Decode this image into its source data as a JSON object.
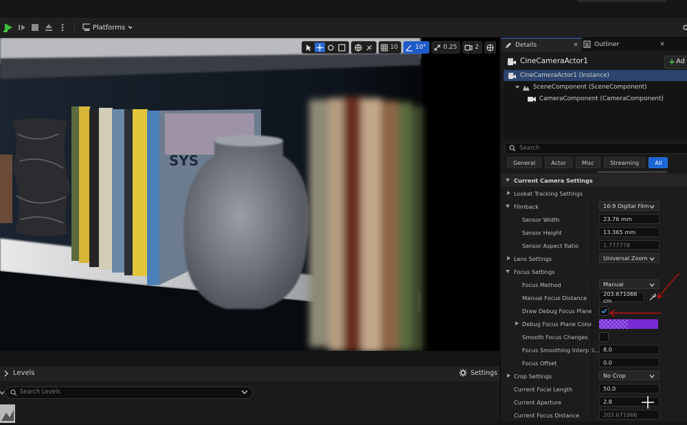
{
  "toolbar": {
    "platforms_label": "Platforms"
  },
  "viewport": {
    "grid_snap": "10",
    "rotation_snap": "10°",
    "scale_snap": "0.25",
    "camera_speed": "2"
  },
  "levels": {
    "title": "Levels",
    "settings_label": "Settings",
    "search_placeholder": "Search Levels"
  },
  "details": {
    "tab_details": "Details",
    "tab_outliner": "Outliner",
    "actor_name": "CineCameraActor1",
    "add_label": "Ad",
    "tree": [
      "CineCameraActor1 (Instance)",
      "SceneComponent (SceneComponent)",
      "CameraComponent (CameraComponent)"
    ],
    "search_placeholder": "Search",
    "filters": [
      "General",
      "Actor",
      "Misc",
      "Streaming",
      "All"
    ],
    "props": {
      "current_camera_settings": "Current Camera Settings",
      "lookat": "Lookat Tracking Settings",
      "filmback": "Filmback",
      "filmback_value": "16:9 Digital Film",
      "sensor_width": "Sensor Width",
      "sensor_width_value": "23.76 mm",
      "sensor_height": "Sensor Height",
      "sensor_height_value": "13.365 mm",
      "sensor_aspect": "Sensor Aspect Ratio",
      "sensor_aspect_value": "1.777778",
      "lens_settings": "Lens Settings",
      "lens_value": "Universal Zoom",
      "focus_settings": "Focus Settings",
      "focus_method": "Focus Method",
      "focus_method_value": "Manual",
      "manual_focus": "Manual Focus Distance",
      "manual_focus_value": "203.671066 cm",
      "draw_debug": "Draw Debug Focus Plane",
      "debug_color": "Debug Focus Plane Color",
      "smooth_focus": "Smooth Focus Changes",
      "focus_interp": "Focus Smoothing Interp S...",
      "focus_interp_value": "8.0",
      "focus_offset": "Focus Offset",
      "focus_offset_value": "0.0",
      "crop_settings": "Crop Settings",
      "crop_value": "No Crop",
      "focal_length": "Current Focal Length",
      "focal_length_value": "50.0",
      "aperture": "Current Aperture",
      "aperture_value": "2.8",
      "focus_distance": "Current Focus Distance",
      "focus_distance_value": "203.671066"
    }
  },
  "colors": {
    "accent_blue": "#1c65d6",
    "selection": "#2b456e",
    "debug_plane_color": "#7a2bd6",
    "annotation_red": "#e01010"
  }
}
